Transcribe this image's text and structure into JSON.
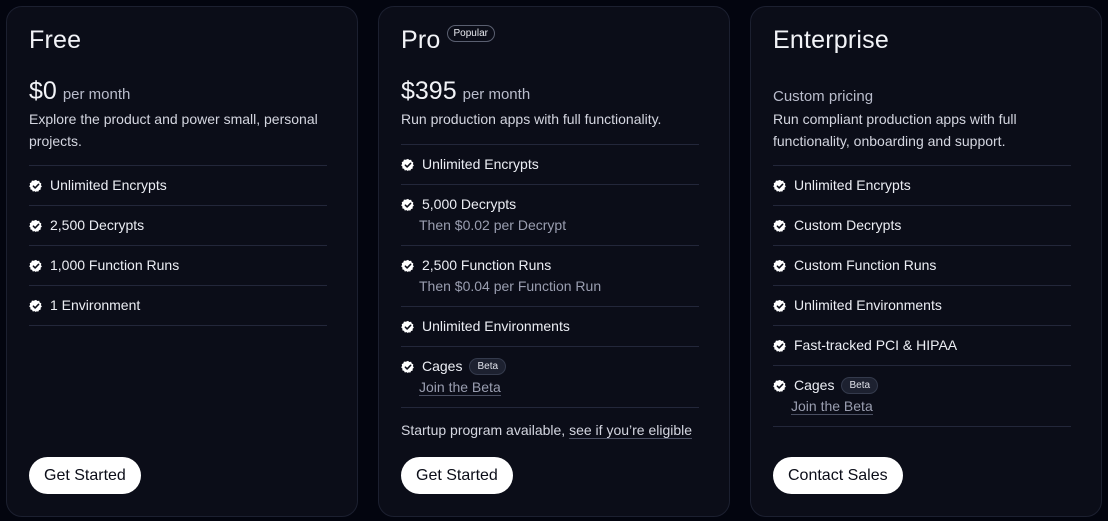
{
  "plans": [
    {
      "name": "Free",
      "price": "$0",
      "period": "per month",
      "description": "Explore the product and power small, personal projects.",
      "features": [
        {
          "label": "Unlimited Encrypts"
        },
        {
          "label": "2,500 Decrypts"
        },
        {
          "label": "1,000 Function Runs"
        },
        {
          "label": "1 Environment"
        }
      ],
      "cta": "Get Started"
    },
    {
      "name": "Pro",
      "badge": "Popular",
      "price": "$395",
      "period": "per month",
      "description": "Run production apps with full functionality.",
      "features": [
        {
          "label": "Unlimited Encrypts"
        },
        {
          "label": "5,000 Decrypts",
          "sub": "Then $0.02 per Decrypt"
        },
        {
          "label": "2,500 Function Runs",
          "sub": "Then $0.04 per Function Run"
        },
        {
          "label": "Unlimited Environments"
        },
        {
          "label": "Cages",
          "badge": "Beta",
          "link": "Join the Beta"
        }
      ],
      "startup_text": "Startup program available, ",
      "startup_link": "see if you’re eligible",
      "cta": "Get Started"
    },
    {
      "name": "Enterprise",
      "pricing_note": "Custom pricing",
      "description": "Run compliant production apps with full functionality, onboarding and support.",
      "features": [
        {
          "label": "Unlimited Encrypts"
        },
        {
          "label": "Custom Decrypts"
        },
        {
          "label": "Custom Function Runs"
        },
        {
          "label": "Unlimited Environments"
        },
        {
          "label": "Fast-tracked PCI & HIPAA"
        },
        {
          "label": "Cages",
          "badge": "Beta",
          "link": "Join the Beta"
        }
      ],
      "cta": "Contact Sales"
    }
  ],
  "icons": {
    "feature": "verified-check-icon"
  },
  "colors": {
    "background": "#03050f",
    "card": "#0b0d18",
    "button": "#ffffff"
  }
}
